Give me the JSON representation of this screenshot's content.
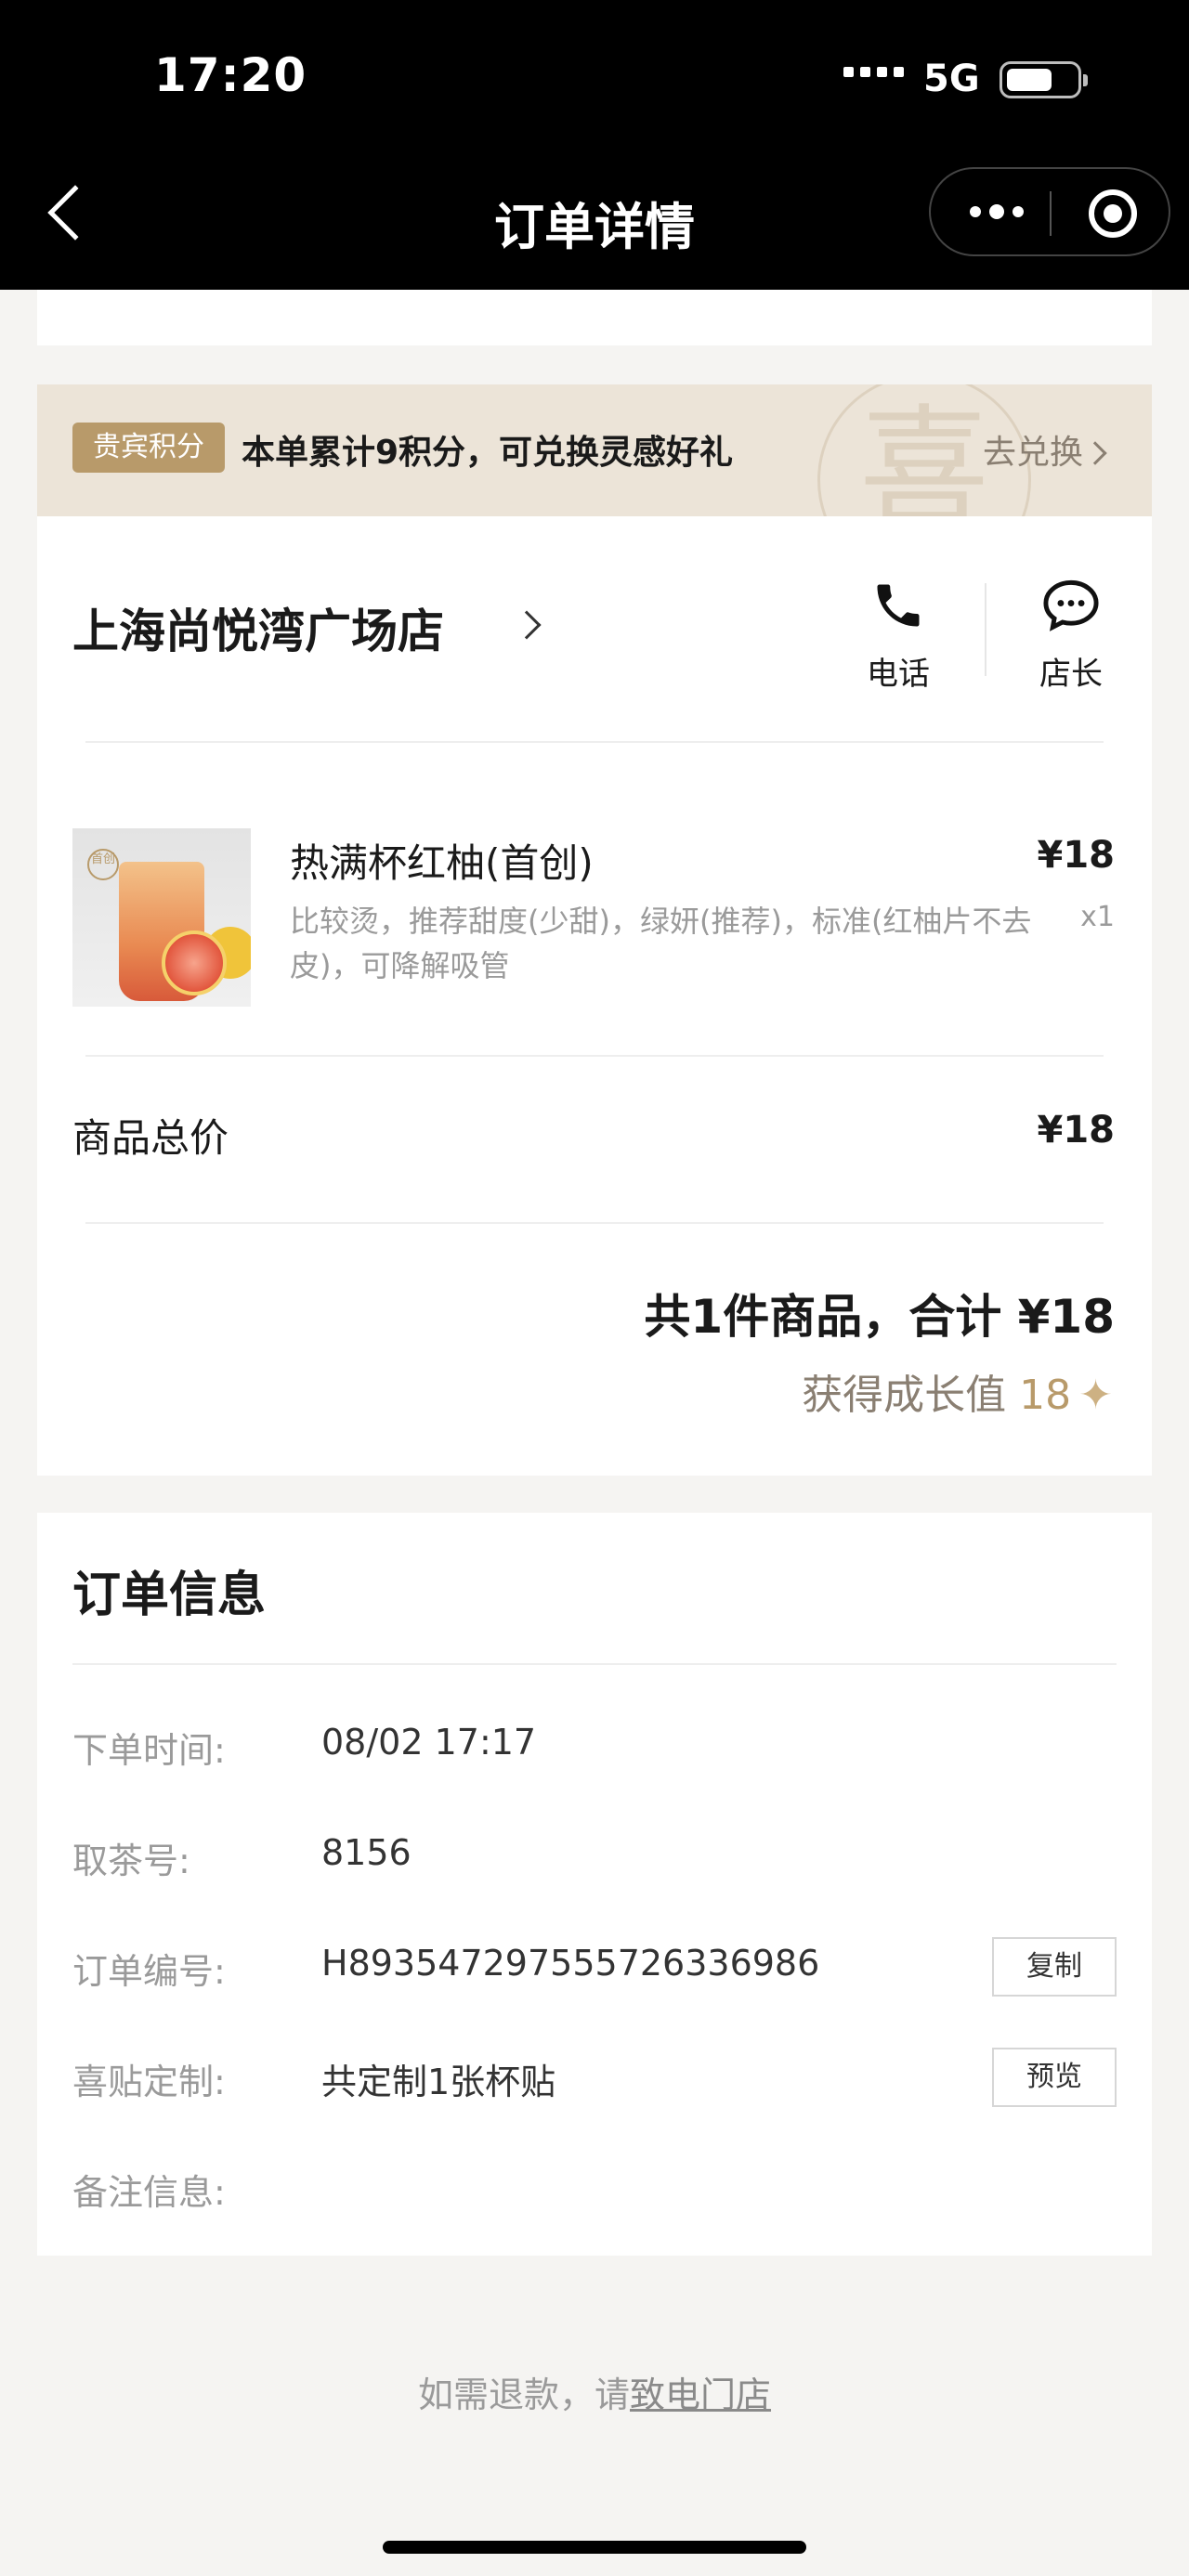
{
  "status_bar": {
    "time": "17:20",
    "network": "5G"
  },
  "nav": {
    "title": "订单详情"
  },
  "points_banner": {
    "badge": "贵宾积分",
    "text": "本单累计9积分，可兑换灵感好礼",
    "link": "去兑换",
    "watermark": "喜"
  },
  "store": {
    "name": "上海尚悦湾广场店",
    "actions": [
      {
        "label": "电话",
        "icon": "phone-icon"
      },
      {
        "label": "店长",
        "icon": "chat-bubble-icon"
      }
    ]
  },
  "product": {
    "seal": "首创",
    "name": "热满杯红柚(首创)",
    "options": "比较烫，推荐甜度(少甜)，绿妍(推荐)，标准(红柚片不去皮)，可降解吸管",
    "price": "¥18",
    "qty": "x1"
  },
  "subtotal": {
    "label": "商品总价",
    "value": "¥18"
  },
  "summary": {
    "total_text": "共1件商品，合计 ¥18",
    "growth_label": "获得成长值",
    "growth_value": "18"
  },
  "order_info": {
    "title": "订单信息",
    "rows": [
      {
        "label": "下单时间:",
        "value": "08/02 17:17"
      },
      {
        "label": "取茶号:",
        "value": "8156"
      },
      {
        "label": "订单编号:",
        "value": "H893547297555726336986",
        "button": "复制"
      },
      {
        "label": "喜贴定制:",
        "value": "共定制1张杯贴",
        "button": "预览"
      },
      {
        "label": "备注信息:",
        "value": ""
      }
    ]
  },
  "footer": {
    "text": "如需退款，请",
    "link": "致电门店"
  },
  "colors": {
    "accent": "#b89a6a",
    "banner_bg": "#ece4d8",
    "page_bg": "#f5f4f2"
  }
}
